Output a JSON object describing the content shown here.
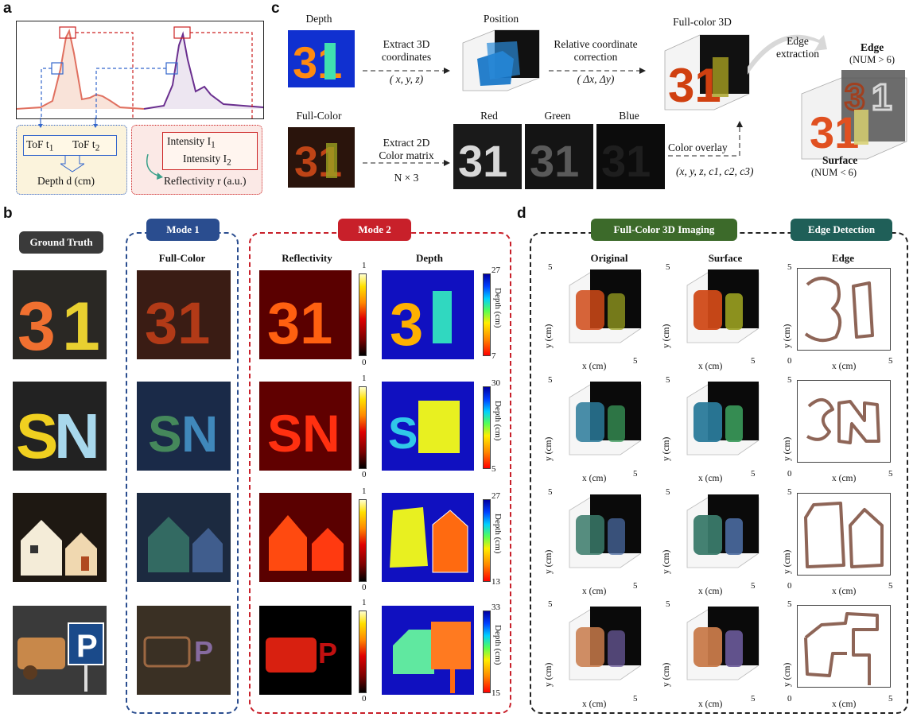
{
  "panels": {
    "a": "a",
    "b": "b",
    "c": "c",
    "d": "d"
  },
  "panel_a": {
    "tof_t1": "ToF t",
    "tof_t1_sub": "1",
    "tof_t2": "ToF t",
    "tof_t2_sub": "2",
    "depth": "Depth d (cm)",
    "intensity_1": "Intensity I",
    "intensity_1_sub": "1",
    "intensity_2": "Intensity I",
    "intensity_2_sub": "2",
    "reflectivity": "Reflectivity r (a.u.)"
  },
  "panel_c": {
    "depth_label": "Depth",
    "position_label": "Position",
    "fullcolor3d_label": "Full-color 3D",
    "extract3d_line1": "Extract 3D",
    "extract3d_line2": "coordinates",
    "extract3d_line3": "( x, y, z)",
    "relcoord_line1": "Relative coordinate",
    "relcoord_line2": "correction",
    "relcoord_line3": "( Δx, Δy)",
    "edge_extraction_line1": "Edge",
    "edge_extraction_line2": "extraction",
    "edge_label": "Edge",
    "edge_num": "(NUM > 6)",
    "surface_label": "Surface",
    "surface_num": "(NUM < 6)",
    "fullcolor_label": "Full-Color",
    "extract2d_line1": "Extract 2D",
    "extract2d_line2": "Color matrix",
    "extract2d_line3": "N × 3",
    "red_label": "Red",
    "green_label": "Green",
    "blue_label": "Blue",
    "color_overlay": "Color overlay",
    "overlay_coords": "(x, y, z, c1, c2, c3)"
  },
  "panel_b": {
    "ground_truth": "Ground Truth",
    "mode1": "Mode 1",
    "mode2": "Mode 2",
    "fullcolor_col": "Full-Color",
    "reflectivity_col": "Reflectivity",
    "depth_col": "Depth",
    "rows": [
      {
        "refl_max": "1",
        "refl_min": "0",
        "depth_max": "27",
        "depth_min": "7",
        "depth_unit": "Depth (cm)"
      },
      {
        "refl_max": "1",
        "refl_min": "0",
        "depth_max": "30",
        "depth_min": "5",
        "depth_unit": "Depth (cm)"
      },
      {
        "refl_max": "1",
        "refl_min": "0",
        "depth_max": "27",
        "depth_min": "13",
        "depth_unit": "Depth (cm)"
      },
      {
        "refl_max": "1",
        "refl_min": "0",
        "depth_max": "33",
        "depth_min": "15",
        "depth_unit": "Depth (cm)"
      }
    ]
  },
  "panel_d": {
    "fc3d_title": "Full-Color 3D Imaging",
    "edge_title": "Edge Detection",
    "col_original": "Original",
    "col_surface": "Surface",
    "col_edge": "Edge",
    "x_label": "x (cm)",
    "y_label": "y (cm)",
    "tick_max": "5",
    "tick_zero": "0"
  },
  "colors": {
    "mode1": "#2a4d8f",
    "mode2": "#c8202a",
    "fc3d": "#3c6a2a",
    "edge": "#1f5f58",
    "gt": "#3a3a3a",
    "blue_dash": "#3366cc",
    "red_dash": "#cc2222"
  }
}
